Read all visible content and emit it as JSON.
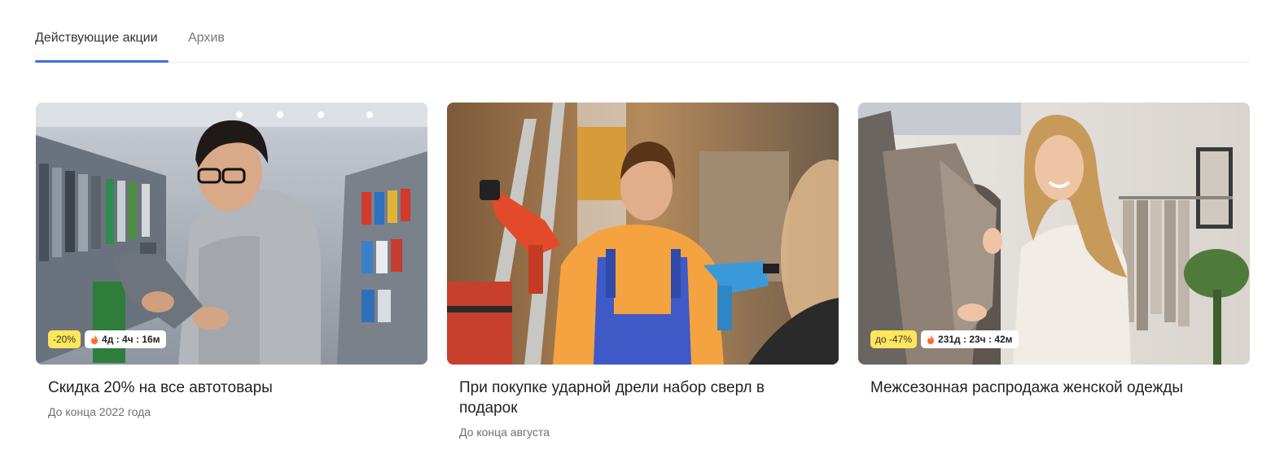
{
  "tabs": [
    {
      "label": "Действующие акции",
      "active": true
    },
    {
      "label": "Архив",
      "active": false
    }
  ],
  "accent_color": "#3f6fd8",
  "badge_color": "#ffe65c",
  "cards": [
    {
      "title": "Скидка 20% на все автотовары",
      "subtitle": "До конца 2022 года",
      "discount": "-20%",
      "timer": "4д : 4ч : 16м",
      "timer_icon": "fire-icon",
      "image": "man-holding-motor-oil-canister-in-auto-store"
    },
    {
      "title": "При покупке ударной дрели набор сверл в подарок",
      "subtitle": "До конца августа",
      "image": "worker-in-overalls-holding-drills"
    },
    {
      "title": "Межсезонная распродажа женской одежды",
      "discount": "до -47%",
      "timer": "231д : 23ч : 42м",
      "timer_icon": "fire-icon",
      "image": "woman-choosing-clothes-in-boutique"
    }
  ]
}
